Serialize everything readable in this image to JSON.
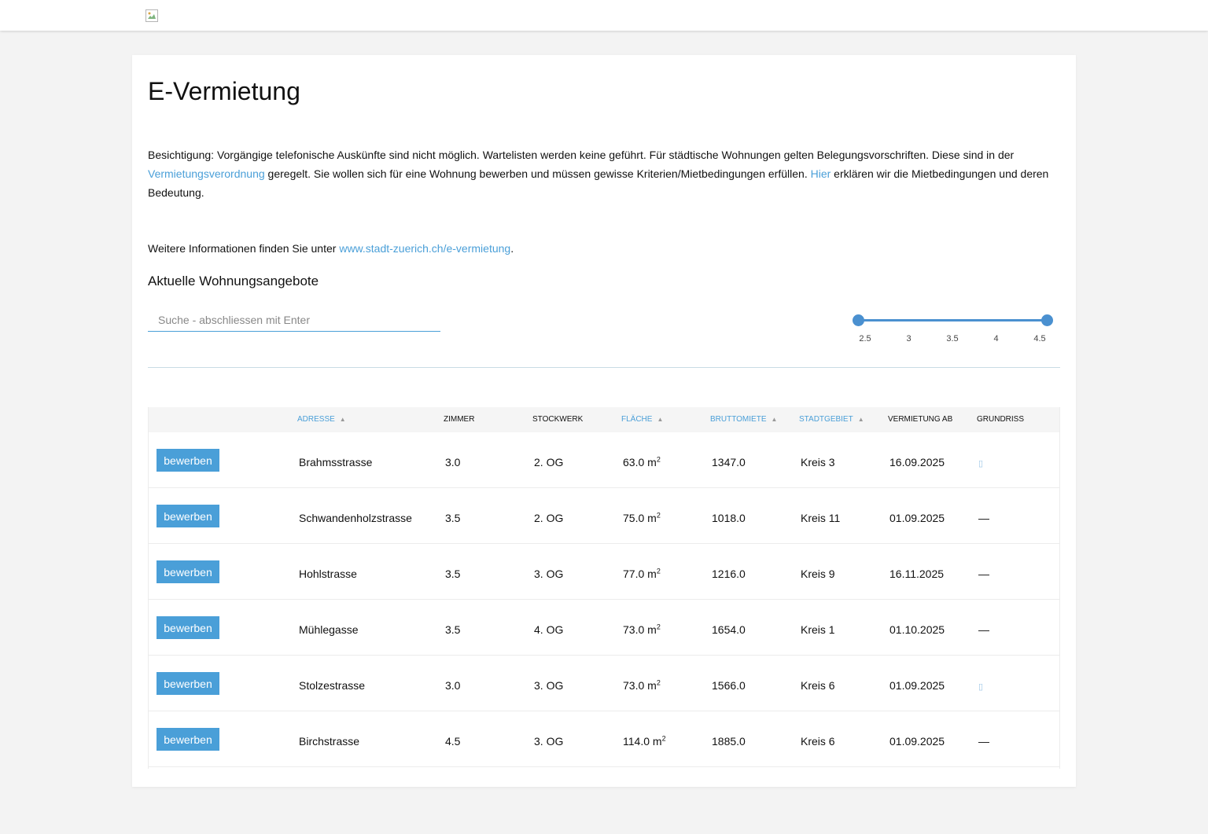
{
  "header": {
    "logo_icon": "broken-image-icon"
  },
  "page": {
    "title": "E-Vermietung",
    "intro": {
      "part1": "Besichtigung: Vorgängige telefonische Auskünfte sind nicht möglich. Wartelisten werden keine geführt. Für städtische Wohnungen gelten Belegungsvorschriften. Diese sind in der ",
      "link1": "Vermietungsverordnung",
      "part2": " geregelt. Sie wollen sich für eine Wohnung bewerben und müssen gewisse Kriterien/Mietbedingungen erfüllen. ",
      "link2": "Hier",
      "part3": " erklären wir die Mietbedingungen und deren Bedeutung."
    },
    "more_info": {
      "text": "Weitere Informationen finden Sie unter ",
      "link": "www.stadt-zuerich.ch/e-vermietung",
      "suffix": "."
    },
    "section_title": "Aktuelle Wohnungsangebote"
  },
  "search": {
    "placeholder": "Suche - abschliessen mit Enter",
    "value": ""
  },
  "room_slider": {
    "ticks": [
      "2.5",
      "3",
      "3.5",
      "4",
      "4.5"
    ],
    "min": 2.5,
    "max": 4.5,
    "selected_low": 2.5,
    "selected_high": 4.5,
    "color": "#4a90d0"
  },
  "table": {
    "columns": {
      "adresse": "ADRESSE",
      "zimmer": "ZIMMER",
      "stockwerk": "STOCKWERK",
      "flaeche": "FLÄCHE",
      "bruttomiete": "BRUTTOMIETE",
      "stadtgebiet": "STADTGEBIET",
      "vermietung_ab": "VERMIETUNG AB",
      "grundriss": "GRUNDRISS"
    },
    "apply_label": "bewerben",
    "area_unit": "m",
    "area_exp": "2",
    "rows": [
      {
        "adresse": "Brahmsstrasse",
        "zimmer": "3.0",
        "stockwerk": "2. OG",
        "flaeche": "63.0",
        "bruttomiete": "1347.0",
        "stadtgebiet": "Kreis 3",
        "vermietung_ab": "16.09.2025",
        "grundriss": "floorplan-icon"
      },
      {
        "adresse": "Schwandenholzstrasse",
        "zimmer": "3.5",
        "stockwerk": "2. OG",
        "flaeche": "75.0",
        "bruttomiete": "1018.0",
        "stadtgebiet": "Kreis 11",
        "vermietung_ab": "01.09.2025",
        "grundriss": "—"
      },
      {
        "adresse": "Hohlstrasse",
        "zimmer": "3.5",
        "stockwerk": "3. OG",
        "flaeche": "77.0",
        "bruttomiete": "1216.0",
        "stadtgebiet": "Kreis 9",
        "vermietung_ab": "16.11.2025",
        "grundriss": "—"
      },
      {
        "adresse": "Mühlegasse",
        "zimmer": "3.5",
        "stockwerk": "4. OG",
        "flaeche": "73.0",
        "bruttomiete": "1654.0",
        "stadtgebiet": "Kreis 1",
        "vermietung_ab": "01.10.2025",
        "grundriss": "—"
      },
      {
        "adresse": "Stolzestrasse",
        "zimmer": "3.0",
        "stockwerk": "3. OG",
        "flaeche": "73.0",
        "bruttomiete": "1566.0",
        "stadtgebiet": "Kreis 6",
        "vermietung_ab": "01.09.2025",
        "grundriss": "floorplan-icon"
      },
      {
        "adresse": "Birchstrasse",
        "zimmer": "4.5",
        "stockwerk": "3. OG",
        "flaeche": "114.0",
        "bruttomiete": "1885.0",
        "stadtgebiet": "Kreis 6",
        "vermietung_ab": "01.09.2025",
        "grundriss": "—"
      }
    ]
  },
  "colors": {
    "accent": "#4a9fd8",
    "background": "#f3f3f3",
    "card": "#ffffff"
  }
}
